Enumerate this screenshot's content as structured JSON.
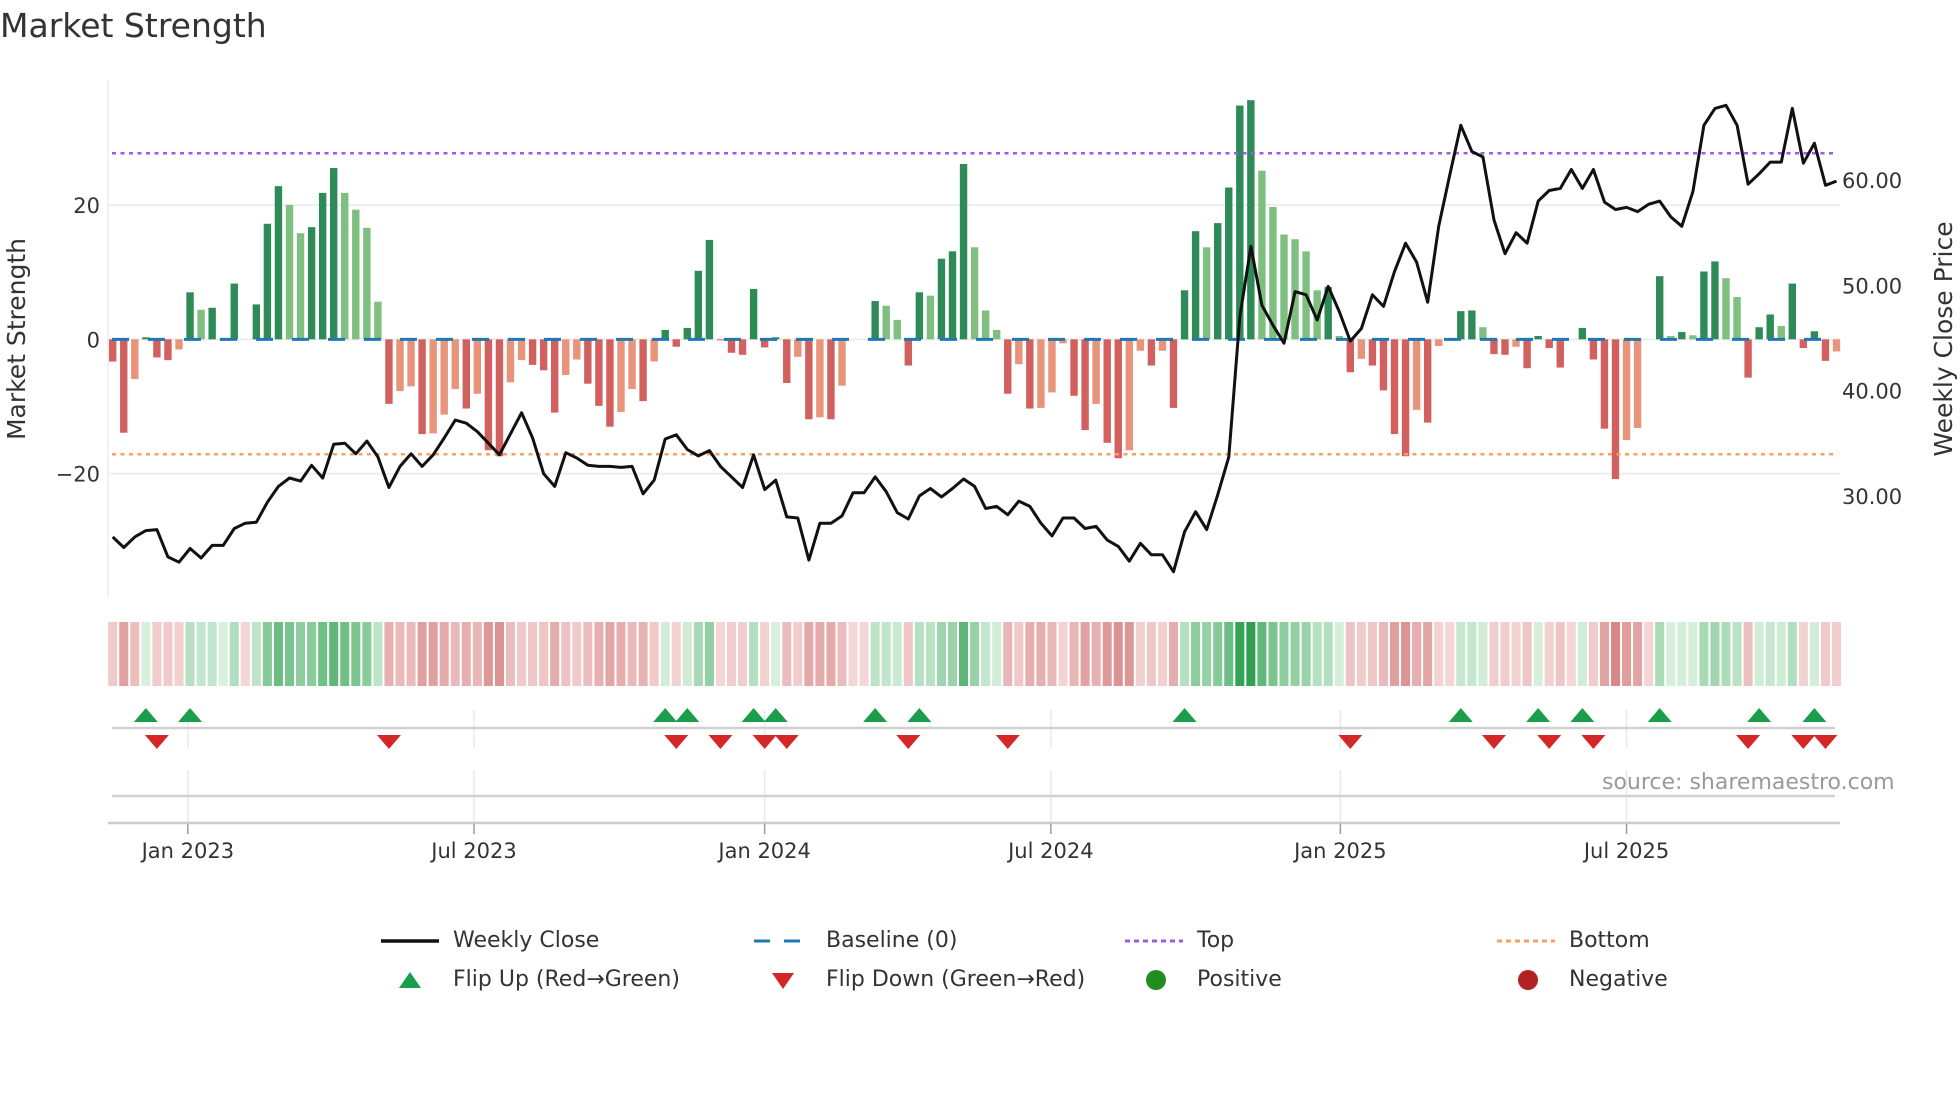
{
  "title": "Market Strength",
  "source": "source: sharemaestro.com",
  "colors": {
    "pos_up": "#2e8b57",
    "pos_down": "#7fbf7f",
    "neg_down": "#d1605e",
    "neg_up": "#e8937a",
    "price": "#111111",
    "baseline": "#1f77b4",
    "top": "#9b5de5",
    "bottom": "#f4a261",
    "flip_up": "#1a9e4a",
    "flip_down": "#d62728",
    "positive": "#228b22",
    "negative": "#b22222"
  },
  "legend": {
    "weekly_close": "Weekly Close",
    "baseline": "Baseline (0)",
    "top": "Top",
    "bottom": "Bottom",
    "flip_up": "Flip Up (Red→Green)",
    "flip_down": "Flip Down (Green→Red)",
    "positive": "Positive",
    "negative": "Negative"
  },
  "chart_data": {
    "type": "bar",
    "title": "Market Strength",
    "ylabel": "Market Strength",
    "y2label": "Weekly Close Price",
    "ylim": [
      -38.5,
      38.6
    ],
    "y2lim": [
      20.3,
      69.5
    ],
    "yticks": [
      {
        "value": 20,
        "label": "20"
      },
      {
        "value": 0,
        "label": "0"
      },
      {
        "value": -20,
        "label": "−20"
      }
    ],
    "y2ticks": [
      {
        "value": 60,
        "label": "60.00"
      },
      {
        "value": 50,
        "label": "50.00"
      },
      {
        "value": 40,
        "label": "40.00"
      },
      {
        "value": 30,
        "label": "30.00"
      }
    ],
    "x_ticks": [
      {
        "label": "Jan 2023",
        "week": 6.8
      },
      {
        "label": "Jul 2023",
        "week": 32.7
      },
      {
        "label": "Jan 2024",
        "week": 59.0
      },
      {
        "label": "Jul 2024",
        "week": 84.9
      },
      {
        "label": "Jan 2025",
        "week": 111.1
      },
      {
        "label": "Jul 2025",
        "week": 137.0
      }
    ],
    "top_level": 27.7,
    "bottom_level": -17.1,
    "strength": [
      -3.3,
      -13.9,
      -5.9,
      0.3,
      -2.7,
      -3.1,
      -1.5,
      7.0,
      4.4,
      4.7,
      0.1,
      8.3,
      0,
      5.2,
      17.2,
      22.8,
      20.0,
      15.8,
      16.7,
      21.8,
      25.5,
      21.8,
      19.3,
      16.6,
      5.6,
      -9.6,
      -7.7,
      -7.0,
      -14.1,
      -14.0,
      -11.2,
      -7.4,
      -10.3,
      -8.1,
      -16.5,
      -17.4,
      -6.4,
      -3.1,
      -3.8,
      -4.6,
      -10.9,
      -5.3,
      -3.0,
      -6.6,
      -9.9,
      -13.0,
      -10.8,
      -7.4,
      -9.2,
      -3.3,
      1.4,
      -1.1,
      1.7,
      10.2,
      14.8,
      -0.1,
      -2.0,
      -2.3,
      7.5,
      -1.2,
      0.3,
      -6.5,
      -2.6,
      -11.9,
      -11.6,
      -11.9,
      -6.9,
      0,
      0,
      5.7,
      5.0,
      2.9,
      -3.9,
      7.0,
      6.5,
      12.0,
      13.1,
      26.1,
      13.7,
      4.3,
      1.4,
      -8.1,
      -3.7,
      -10.3,
      -10.2,
      -7.9,
      -0.6,
      -8.4,
      -13.5,
      -9.6,
      -15.4,
      -17.7,
      -16.5,
      -1.7,
      -3.9,
      -1.7,
      -10.2,
      7.3,
      16.1,
      13.7,
      17.3,
      22.6,
      34.8,
      35.6,
      25.1,
      19.7,
      15.6,
      14.9,
      13.1,
      7.3,
      7.8,
      0.5,
      -4.9,
      -2.9,
      -3.9,
      -7.6,
      -14.1,
      -17.4,
      -10.5,
      -12.4,
      -1.0,
      0,
      4.2,
      4.3,
      1.8,
      -2.2,
      -2.3,
      -1.1,
      -4.3,
      0.5,
      -1.3,
      -4.2,
      0,
      1.7,
      -3.0,
      -13.3,
      -20.8,
      -15.0,
      -13.2,
      0,
      9.4,
      0.5,
      1.1,
      0.6,
      10.1,
      11.6,
      9.1,
      6.3,
      -5.7,
      1.8,
      3.7,
      2.0,
      8.3,
      -1.3,
      1.2,
      -3.2,
      -1.8
    ],
    "weekly_close": [
      26.1,
      25.1,
      26.1,
      26.7,
      26.8,
      24.2,
      23.7,
      25.0,
      24.1,
      25.3,
      25.3,
      26.9,
      27.4,
      27.5,
      29.4,
      30.9,
      31.7,
      31.4,
      32.9,
      31.7,
      34.9,
      35.0,
      34.0,
      35.2,
      33.7,
      30.8,
      32.8,
      34.0,
      32.8,
      33.9,
      35.5,
      37.2,
      36.9,
      36.1,
      35.0,
      33.9,
      35.9,
      37.9,
      35.5,
      32.1,
      30.9,
      34.1,
      33.6,
      32.9,
      32.8,
      32.8,
      32.7,
      32.8,
      30.2,
      31.5,
      35.4,
      35.8,
      34.4,
      33.8,
      34.3,
      32.8,
      31.8,
      30.8,
      33.9,
      30.6,
      31.5,
      28.0,
      27.9,
      23.9,
      27.4,
      27.4,
      28.1,
      30.3,
      30.3,
      31.8,
      30.4,
      28.4,
      27.8,
      30.0,
      30.7,
      29.9,
      30.7,
      31.6,
      30.9,
      28.8,
      29.0,
      28.2,
      29.5,
      29.0,
      27.4,
      26.2,
      27.9,
      27.9,
      26.9,
      27.1,
      25.8,
      25.2,
      23.8,
      25.5,
      24.4,
      24.4,
      22.8,
      26.6,
      28.5,
      26.8,
      30.1,
      33.7,
      47.0,
      53.7,
      48.1,
      46.2,
      44.5,
      49.4,
      49.1,
      46.7,
      49.9,
      47.5,
      44.7,
      45.9,
      49.1,
      48.0,
      51.3,
      54.0,
      52.2,
      48.4,
      55.6,
      60.5,
      65.2,
      62.7,
      62.2,
      56.2,
      53.0,
      55.0,
      54.0,
      58.0,
      59.0,
      59.2,
      61.0,
      59.2,
      61.0,
      57.9,
      57.2,
      57.4,
      57.0,
      57.7,
      58.0,
      56.5,
      55.6,
      58.9,
      65.2,
      66.8,
      67.1,
      65.2,
      59.6,
      60.6,
      61.7,
      61.7,
      66.8,
      61.6,
      63.5,
      59.5,
      59.9
    ],
    "flip_up_weeks": [
      3,
      7,
      50,
      52,
      58,
      60,
      69,
      73,
      97,
      122,
      129,
      133,
      140,
      149,
      154
    ],
    "flip_down_weeks": [
      4,
      25,
      51,
      55,
      59,
      61,
      72,
      81,
      112,
      125,
      130,
      134,
      148,
      153,
      155
    ],
    "legend_position": "bottom"
  }
}
